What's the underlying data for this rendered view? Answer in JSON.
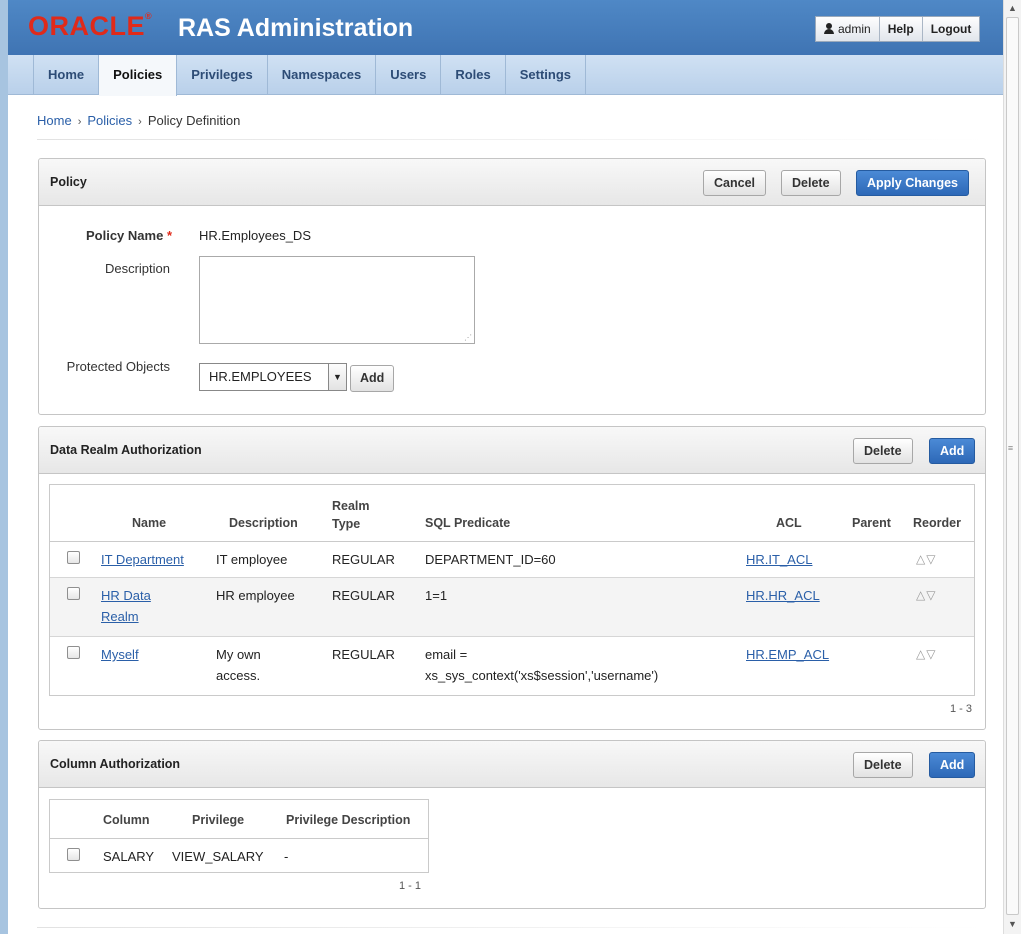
{
  "header": {
    "logo": "ORACLE",
    "title": "RAS Administration",
    "user": "admin",
    "help": "Help",
    "logout": "Logout"
  },
  "tabs": [
    {
      "label": "Home"
    },
    {
      "label": "Policies",
      "active": true
    },
    {
      "label": "Privileges"
    },
    {
      "label": "Namespaces"
    },
    {
      "label": "Users"
    },
    {
      "label": "Roles"
    },
    {
      "label": "Settings"
    }
  ],
  "breadcrumb": [
    "Home",
    "Policies",
    "Policy Definition"
  ],
  "policy": {
    "title": "Policy",
    "cancel": "Cancel",
    "delete": "Delete",
    "apply": "Apply Changes",
    "name_label": "Policy Name",
    "required_marker": "*",
    "name_value": "HR.Employees_DS",
    "description_label": "Description",
    "description_value": "",
    "objects_label": "Protected Objects",
    "objects_value": "HR.EMPLOYEES",
    "add": "Add"
  },
  "realm": {
    "title": "Data Realm Authorization",
    "delete": "Delete",
    "add": "Add",
    "headers": {
      "name": "Name",
      "description": "Description",
      "realm_type_1": "Realm",
      "realm_type_2": "Type",
      "sql": "SQL Predicate",
      "acl": "ACL",
      "parent": "Parent",
      "reorder": "Reorder"
    },
    "rows": [
      {
        "name": "IT Department",
        "description": "IT employee",
        "type": "REGULAR",
        "sql": "DEPARTMENT_ID=60",
        "acl": "HR.IT_ACL",
        "parent": ""
      },
      {
        "name_1": "HR Data",
        "name_2": "Realm",
        "description": "HR employee",
        "type": "REGULAR",
        "sql": "1=1",
        "acl": "HR.HR_ACL",
        "parent": ""
      },
      {
        "name": "Myself",
        "description_1": "My own",
        "description_2": "access.",
        "type": "REGULAR",
        "sql_1": "email =",
        "sql_2": "xs_sys_context('xs$session','username')",
        "acl": "HR.EMP_ACL",
        "parent": ""
      }
    ],
    "pager": "1 - 3"
  },
  "column": {
    "title": "Column Authorization",
    "delete": "Delete",
    "add": "Add",
    "headers": {
      "column": "Column",
      "privilege": "Privilege",
      "description": "Privilege Description"
    },
    "rows": [
      {
        "column": "SALARY",
        "privilege": "VIEW_SALARY",
        "description": "-"
      }
    ],
    "pager": "1 - 1"
  },
  "icons": {
    "reorder_up": "△",
    "reorder_down": "▽",
    "dropdown": "▼",
    "breadcrumb_sep": "›",
    "scroll_up": "▲",
    "scroll_down": "▼"
  },
  "colors": {
    "header_bg": "#4580c0",
    "logo": "#e02a1a",
    "tab_bar": "#c4d8ee",
    "primary_button": "#2d68b7",
    "link": "#2a5fa8"
  }
}
